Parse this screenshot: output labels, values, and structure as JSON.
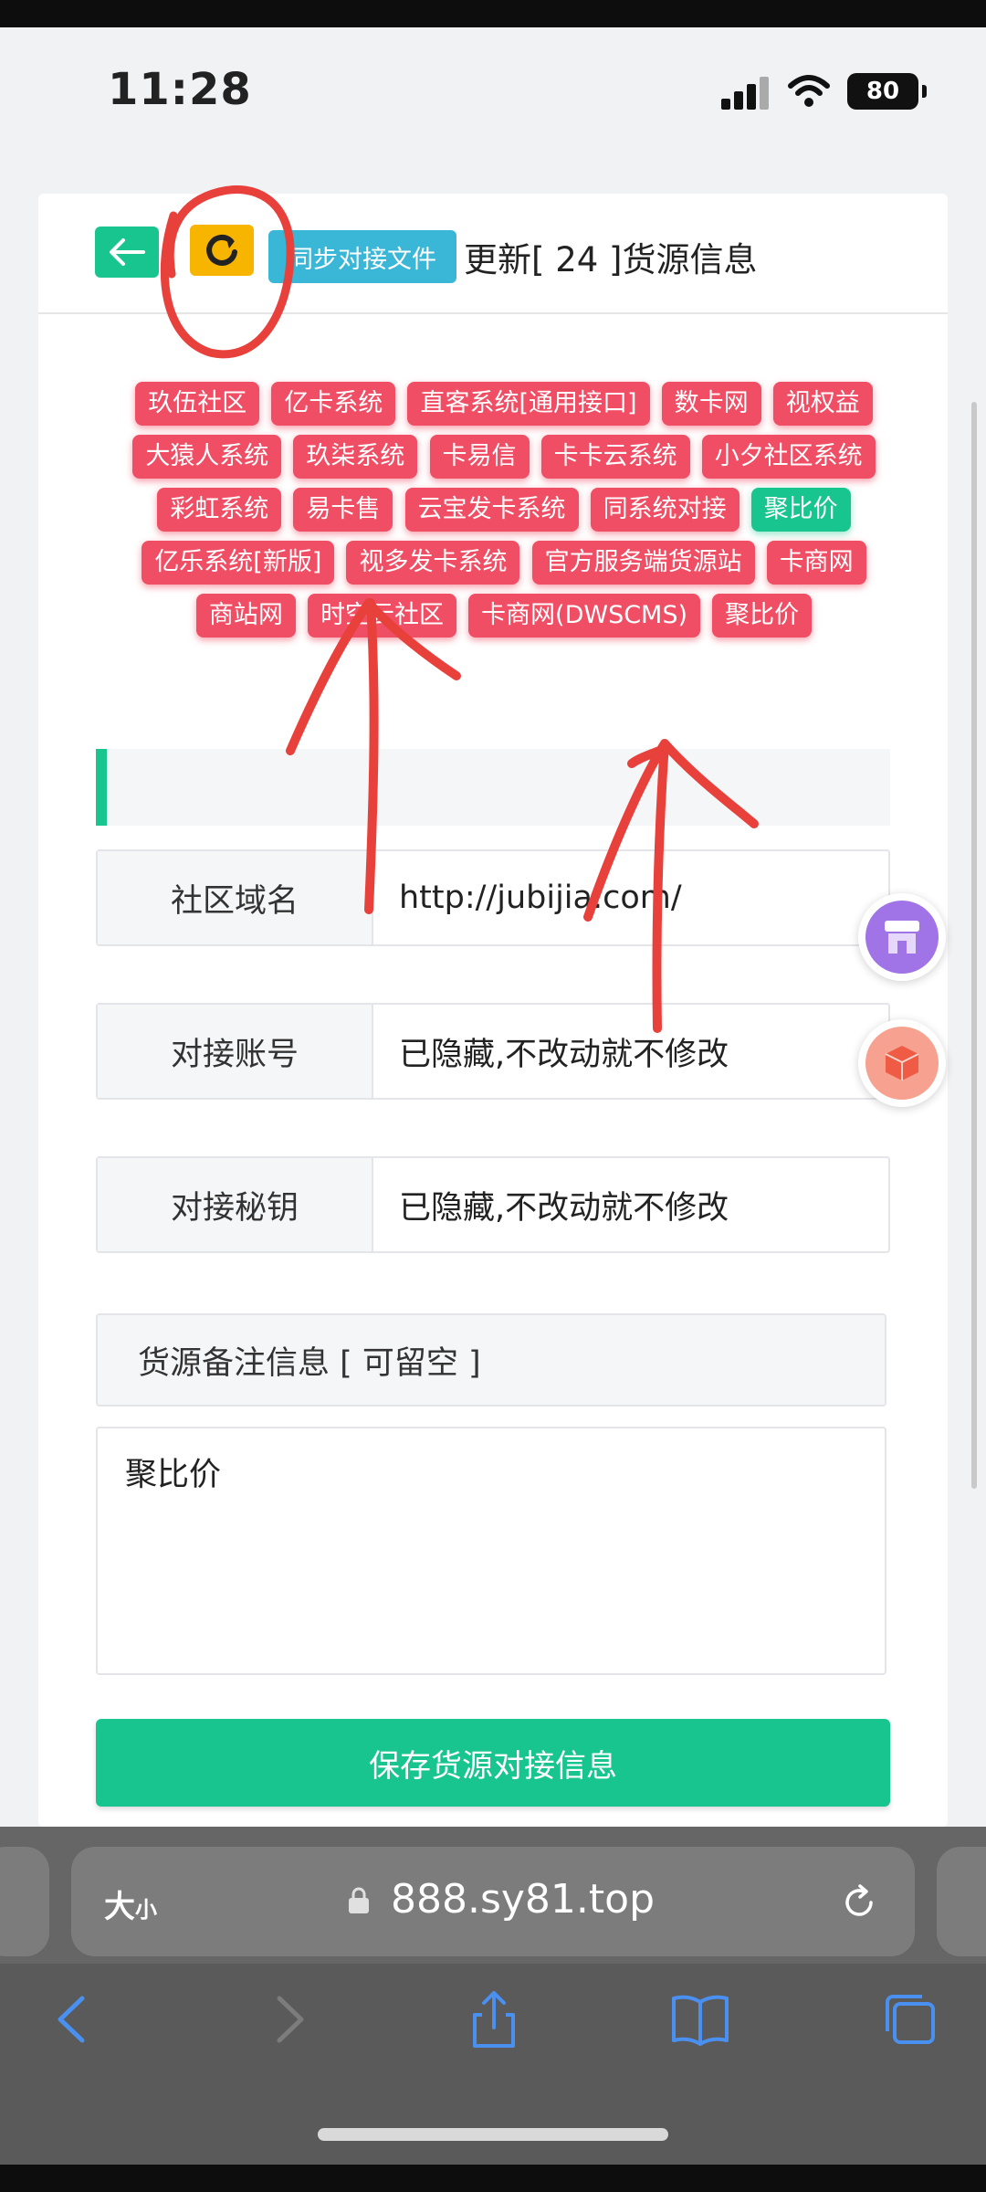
{
  "status": {
    "time": "11:28",
    "battery": "80"
  },
  "header": {
    "title": "更新[ 24 ]货源信息",
    "sync_label": "同步对接文件"
  },
  "tags": [
    {
      "label": "玖伍社区",
      "active": false
    },
    {
      "label": "亿卡系统",
      "active": false
    },
    {
      "label": "直客系统[通用接口]",
      "active": false
    },
    {
      "label": "数卡网",
      "active": false
    },
    {
      "label": "视权益",
      "active": false
    },
    {
      "label": "大猿人系统",
      "active": false
    },
    {
      "label": "玖柒系统",
      "active": false
    },
    {
      "label": "卡易信",
      "active": false
    },
    {
      "label": "卡卡云系统",
      "active": false
    },
    {
      "label": "小夕社区系统",
      "active": false
    },
    {
      "label": "彩虹系统",
      "active": false
    },
    {
      "label": "易卡售",
      "active": false
    },
    {
      "label": "云宝发卡系统",
      "active": false
    },
    {
      "label": "同系统对接",
      "active": false
    },
    {
      "label": "聚比价",
      "active": true
    },
    {
      "label": "亿乐系统[新版]",
      "active": false
    },
    {
      "label": "视多发卡系统",
      "active": false
    },
    {
      "label": "官方服务端货源站",
      "active": false
    },
    {
      "label": "卡商网",
      "active": false
    },
    {
      "label": "商站网",
      "active": false
    },
    {
      "label": "时空云社区",
      "active": false
    },
    {
      "label": "卡商网(DWSCMS)",
      "active": false
    },
    {
      "label": "聚比价",
      "active": false
    }
  ],
  "form": {
    "domain_label": "社区域名",
    "domain_value": "http://jubijia.com/",
    "account_label": "对接账号",
    "account_value": "已隐藏,不改动就不修改",
    "secret_label": "对接秘钥",
    "secret_value": "已隐藏,不改动就不修改",
    "note_label": "货源备注信息 [ 可留空 ]",
    "note_value": "聚比价",
    "save_label": "保存货源对接信息"
  },
  "browser": {
    "text_size": "大",
    "text_size_small": "小",
    "url": "888.sy81.top"
  },
  "colors": {
    "green": "#19c58e",
    "yellow": "#f7b500",
    "cyan": "#3ab6d6",
    "tag_red": "#f04e64",
    "annotation_red": "#e8413c"
  },
  "icons": [
    "back-arrow-icon",
    "refresh-icon",
    "store-icon",
    "box-icon",
    "lock-icon",
    "reload-icon",
    "nav-back-icon",
    "nav-forward-icon",
    "share-icon",
    "bookmarks-icon",
    "tabs-icon"
  ]
}
